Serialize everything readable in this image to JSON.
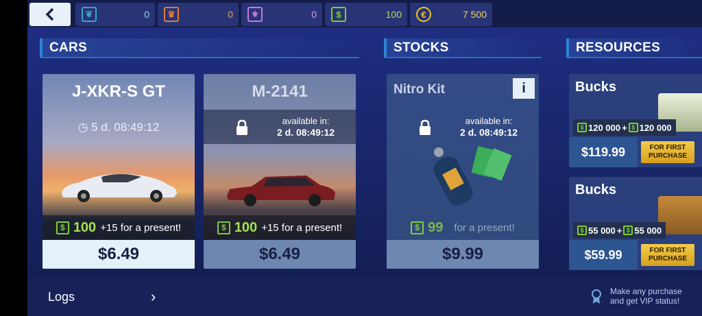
{
  "topbar": {
    "back_icon": "chevron-left-icon",
    "currencies": [
      {
        "icon": "laurel-icon",
        "color": "#3aa7c8",
        "value": "0"
      },
      {
        "icon": "crown-icon",
        "color": "#e07a3a",
        "value": "0"
      },
      {
        "icon": "fleur-de-lis-icon",
        "color": "#c77ad8",
        "value": "0"
      },
      {
        "icon": "dollar-icon",
        "color": "#7ed02c",
        "value": "100"
      },
      {
        "icon": "coin-icon",
        "color": "#f0c420",
        "value": "7 500"
      }
    ]
  },
  "sections": {
    "cars": "CARS",
    "stocks": "STOCKS",
    "resources": "RESOURCES"
  },
  "cars": [
    {
      "name": "J-XKR-S GT",
      "timer": "5 d. 08:49:12",
      "bucks": "100",
      "present": "+15 for a present!",
      "price": "$6.49"
    },
    {
      "name": "M-2141",
      "available_label": "available in:",
      "timer": "2 d. 08:49:12",
      "bucks": "100",
      "present": "+15 for a present!",
      "price": "$6.49"
    }
  ],
  "stocks": [
    {
      "name": "Nitro Kit",
      "info": "i",
      "available_label": "available in:",
      "timer": "2 d. 08:49:12",
      "bucks": "99",
      "present": "for a present!",
      "price": "$9.99"
    }
  ],
  "resources": [
    {
      "name": "Bucks",
      "amount": "120 000",
      "bonus": "120 000",
      "price": "$119.99",
      "first_purchase": "FOR FIRST PURCHASE"
    },
    {
      "name": "Bucks",
      "amount": "55 000",
      "bonus": "55 000",
      "price": "$59.99",
      "first_purchase": "FOR FIRST PURCHASE"
    }
  ],
  "footer": {
    "logs": "Logs",
    "vip_line1": "Make any purchase",
    "vip_line2": "and get VIP status!"
  }
}
